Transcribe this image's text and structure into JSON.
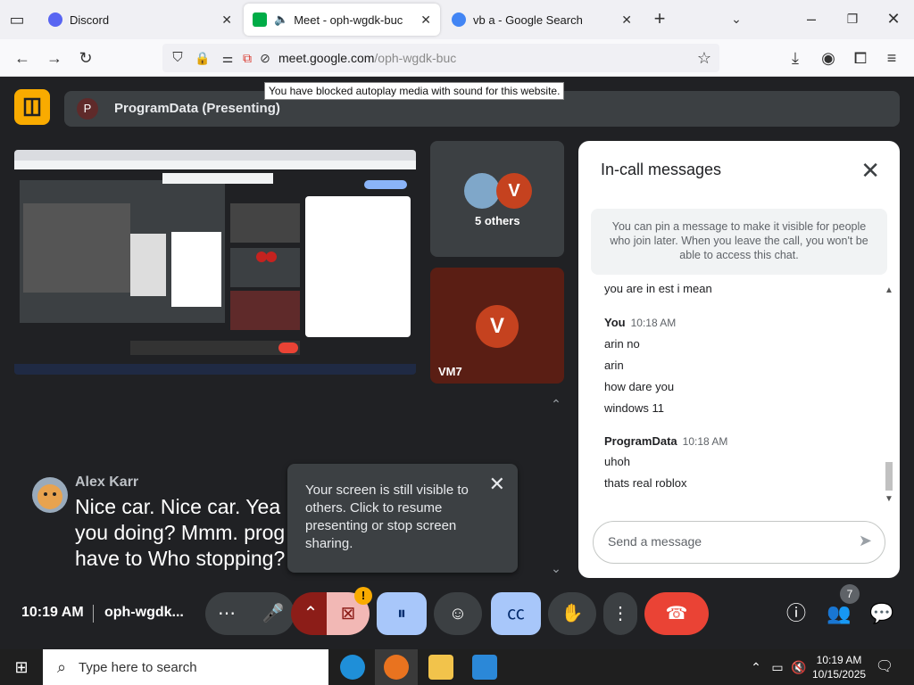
{
  "browser": {
    "tabs": [
      {
        "label": "Discord",
        "color": "#5865f2"
      },
      {
        "label": "Meet - oph-wgdk-buc",
        "color": "#00ac47"
      },
      {
        "label": "vb a - Google Search",
        "color": "#4285f4"
      }
    ],
    "url_host": "meet.google.com",
    "url_path": "/oph-wgdk-buc",
    "tooltip": "You have blocked autoplay media with sound for this website."
  },
  "meet": {
    "presenting_initial": "P",
    "presenting_label": "ProgramData (Presenting)",
    "tiles": {
      "others_label": "5 others",
      "others_initial": "V",
      "vm7_initial": "V",
      "vm7_name": "VM7"
    },
    "caption": {
      "speaker": "Alex Karr",
      "text": "Nice car. Nice car. Yea\nyou doing? Mmm. prog\nhave to Who stopping?"
    },
    "notice": {
      "text": "Your screen is still visible to others. Click to resume presenting or stop screen sharing."
    },
    "chat": {
      "title": "In-call messages",
      "info": "You can pin a message to make it visible for people who join later. When you leave the call, you won't be able to access this chat.",
      "partial_line": "you are in est i mean",
      "groups": [
        {
          "sender": "You",
          "time": "10:18 AM",
          "lines": [
            "arin no",
            "arin",
            "how dare you",
            "windows 11"
          ]
        },
        {
          "sender": "ProgramData",
          "time": "10:18 AM",
          "lines": [
            "uhoh",
            "thats real roblox"
          ]
        }
      ],
      "input_placeholder": "Send a message"
    },
    "bottom": {
      "time": "10:19 AM",
      "code": "oph-wgdk...",
      "people_count": "7"
    }
  },
  "taskbar": {
    "search_placeholder": "Type here to search",
    "time": "10:19 AM",
    "date": "10/15/2025"
  }
}
